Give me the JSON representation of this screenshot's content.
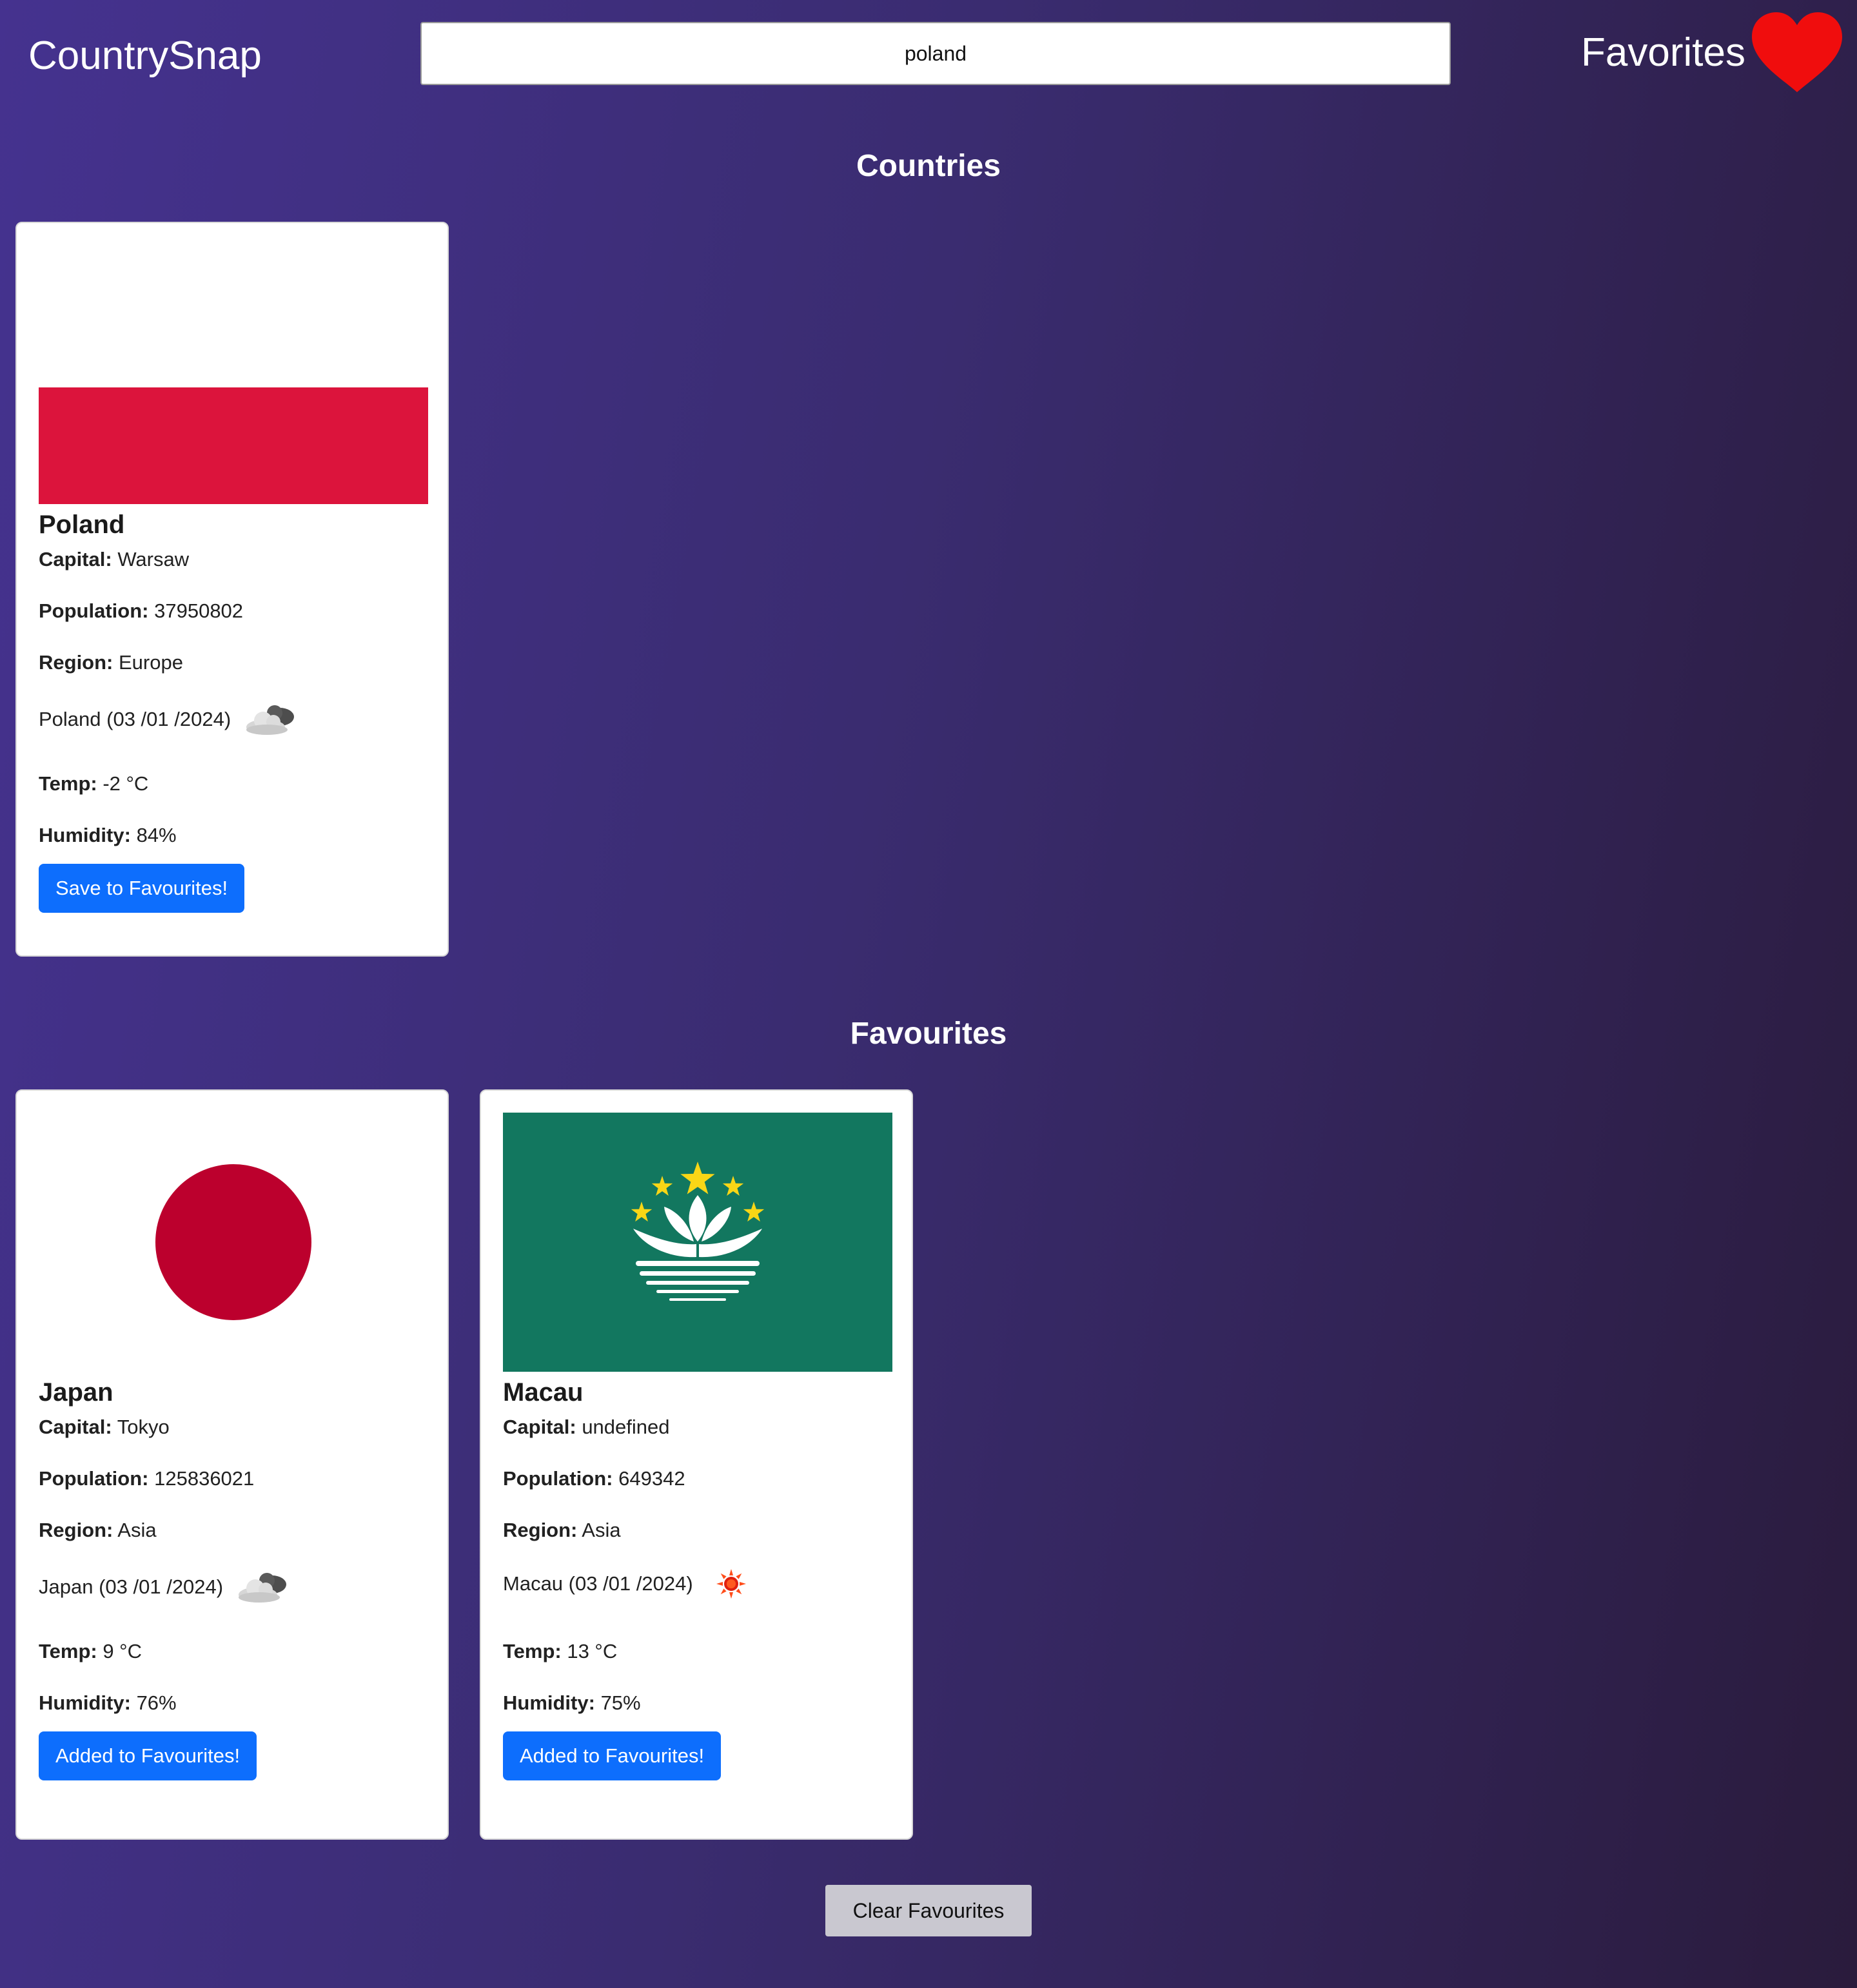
{
  "header": {
    "app_title": "CountrySnap",
    "search_value": "poland",
    "favorites_label": "Favorites",
    "favorites_icon": "heart-icon",
    "heart_color": "#f00d0d"
  },
  "sections": {
    "countries_title": "Countries",
    "favourites_title": "Favourites"
  },
  "labels": {
    "capital": "Capital:",
    "population": "Population:",
    "region": "Region:",
    "temp": "Temp:",
    "humidity": "Humidity:"
  },
  "countries": [
    {
      "name": "Poland",
      "flag": "poland-flag",
      "capital": "Warsaw",
      "population": "37950802",
      "region": "Europe",
      "weather_title": "Poland (03 /01 /2024)",
      "weather_icon": "cloud-icon",
      "temp": "-2 °C",
      "humidity": "84%",
      "button_label": "Save to Favourites!"
    }
  ],
  "favourites": [
    {
      "name": "Japan",
      "flag": "japan-flag",
      "capital": "Tokyo",
      "population": "125836021",
      "region": "Asia",
      "weather_title": "Japan (03 /01 /2024)",
      "weather_icon": "cloud-icon",
      "temp": "9 °C",
      "humidity": "76%",
      "button_label": "Added to Favourites!"
    },
    {
      "name": "Macau",
      "flag": "macau-flag",
      "capital": "undefined",
      "population": "649342",
      "region": "Asia",
      "weather_title": "Macau (03 /01 /2024)",
      "weather_icon": "sun-icon",
      "temp": "13 °C",
      "humidity": "75%",
      "button_label": "Added to Favourites!"
    }
  ],
  "clear_button_label": "Clear Favourites",
  "colors": {
    "primary_button": "#0d6efd",
    "poland_red": "#dc143c",
    "japan_red": "#bc002d",
    "macau_green": "#12775f",
    "macau_star": "#f9d616"
  }
}
